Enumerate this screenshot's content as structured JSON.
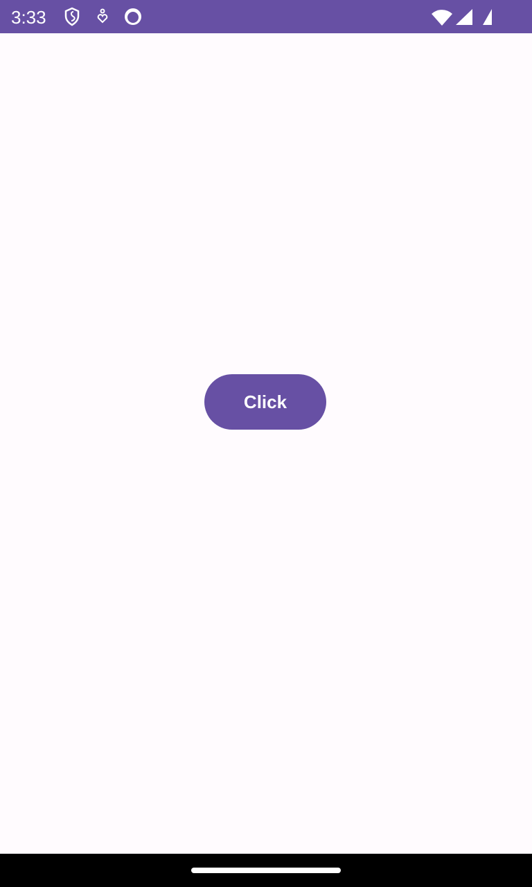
{
  "status_bar": {
    "time": "3:33",
    "icons": [
      "shield-icon",
      "download-heart-icon",
      "cat-icon",
      "wifi-icon",
      "signal-icon",
      "signal-icon-2"
    ],
    "color": "#6750a4"
  },
  "main": {
    "button_label": "Click"
  }
}
